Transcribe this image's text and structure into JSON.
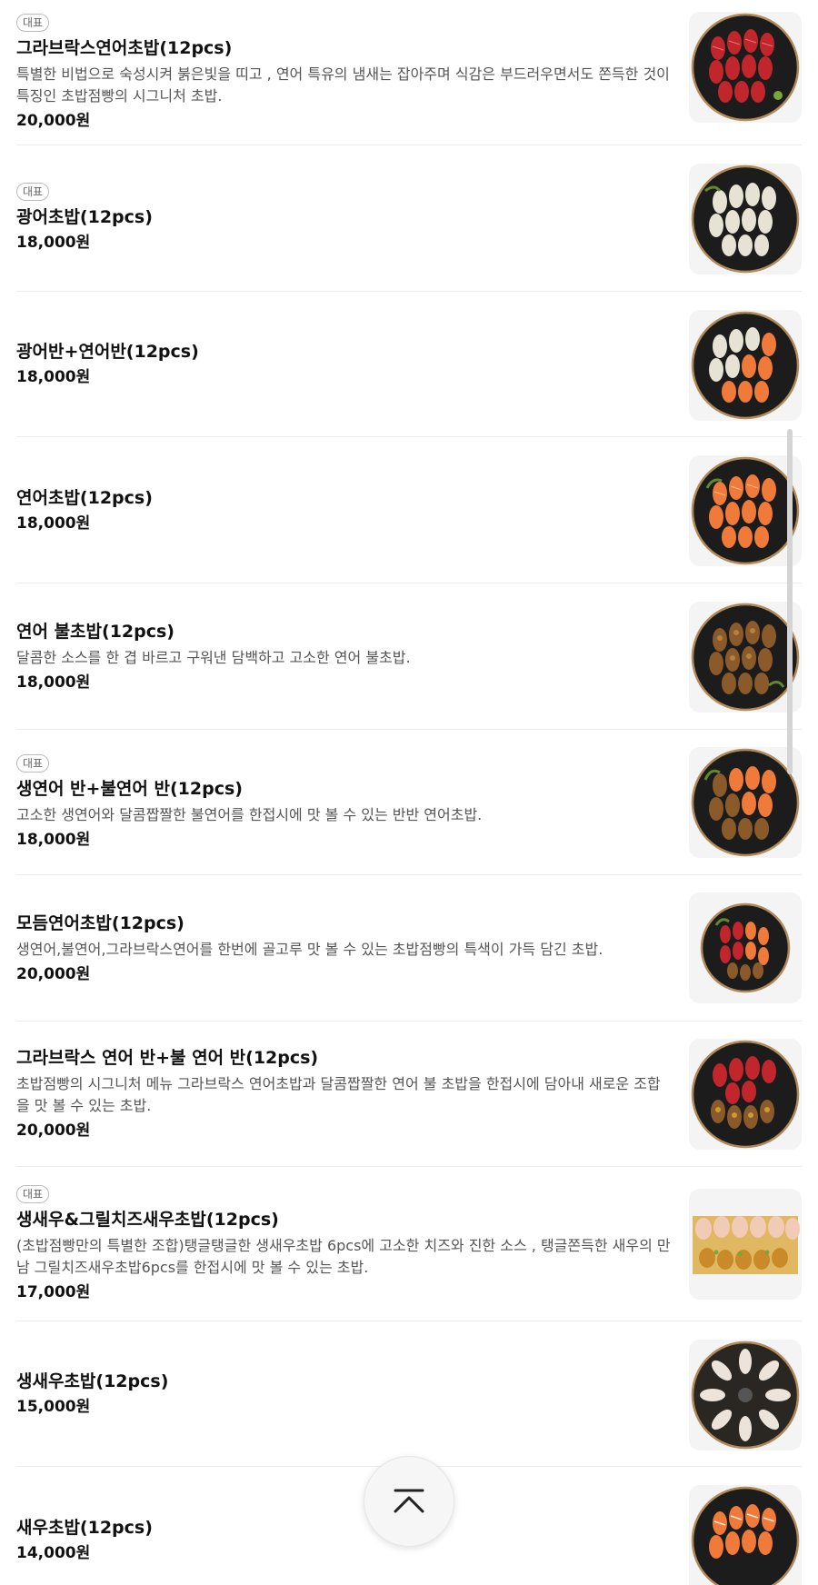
{
  "menu": {
    "badge_label": "대표",
    "items": [
      {
        "name": "그라브락스연어초밥(12pcs)",
        "badge": true,
        "desc": "특별한 비법으로 숙성시켜 붉은빛을 띠고 , 연어 특유의 냄새는 잡아주며 식감은 부드러우면서도 쫀득한 것이 특징인 초밥점빵의 시그니처 초밥.",
        "price": "20,000원",
        "image": "red-salmon-sushi-plate"
      },
      {
        "name": "광어초밥(12pcs)",
        "badge": true,
        "desc": "",
        "price": "18,000원",
        "image": "flatfish-sushi-plate"
      },
      {
        "name": "광어반+연어반(12pcs)",
        "badge": false,
        "desc": "",
        "price": "18,000원",
        "image": "flatfish-salmon-sushi-plate"
      },
      {
        "name": "연어초밥(12pcs)",
        "badge": false,
        "desc": "",
        "price": "18,000원",
        "image": "salmon-sushi-plate"
      },
      {
        "name": "연어 불초밥(12pcs)",
        "badge": false,
        "desc": "달콤한 소스를 한 겹 바르고 구워낸 담백하고 고소한 연어 불초밥.",
        "price": "18,000원",
        "image": "seared-salmon-sushi-plate"
      },
      {
        "name": "생연어 반+불연어 반(12pcs)",
        "badge": true,
        "desc": "고소한 생연어와 달콤짭짤한 불연어를 한접시에 맛 볼 수 있는 반반 연어초밥.",
        "price": "18,000원",
        "image": "raw-seared-salmon-sushi-plate"
      },
      {
        "name": "모듬연어초밥(12pcs)",
        "badge": false,
        "desc": "생연어,불연어,그라브락스연어를 한번에 골고루 맛 볼 수 있는 초밥점빵의 특색이 가득 담긴 초밥.",
        "price": "20,000원",
        "image": "assorted-salmon-sushi-plate"
      },
      {
        "name": "그라브락스 연어 반+불 연어 반(12pcs)",
        "badge": false,
        "desc": "초밥점빵의 시그니처 메뉴 그라브락스 연어초밥과 달콤짭짤한 연어 불 초밥을 한접시에 담아내 새로운 조합을 맛 볼 수 있는 초밥.",
        "price": "20,000원",
        "image": "gravlax-seared-salmon-sushi-plate"
      },
      {
        "name": "생새우&그릴치즈새우초밥(12pcs)",
        "badge": true,
        "desc": "(초밥점빵만의 특별한 조합)탱글탱글한 생새우초밥 6pcs에 고소한 치즈와 진한 소스 , 탱글쫀득한 새우의 만남 그릴치즈새우초밥6pcs를 한접시에 맛 볼 수 있는 초밥.",
        "price": "17,000원",
        "image": "shrimp-cheese-sushi-tray"
      },
      {
        "name": "생새우초밥(12pcs)",
        "badge": false,
        "desc": "",
        "price": "15,000원",
        "image": "raw-shrimp-sushi-plate"
      },
      {
        "name": "새우초밥(12pcs)",
        "badge": false,
        "desc": "",
        "price": "14,000원",
        "image": "shrimp-sushi-plate"
      }
    ]
  },
  "scroll_top_button": {
    "icon": "chevron-up-icon"
  },
  "colors": {
    "background": "#ffffff",
    "divider": "#ececec",
    "badge_border": "#bbbbbb",
    "description": "#555555",
    "plate": "#1c1c1c",
    "plate_rim": "#b08a5a",
    "salmon": "#f07a3a",
    "gravlax": "#c0262c",
    "seared": "#8a5a2a",
    "flatfish": "#e6e3d4",
    "shrimp": "#f1cbb6"
  }
}
